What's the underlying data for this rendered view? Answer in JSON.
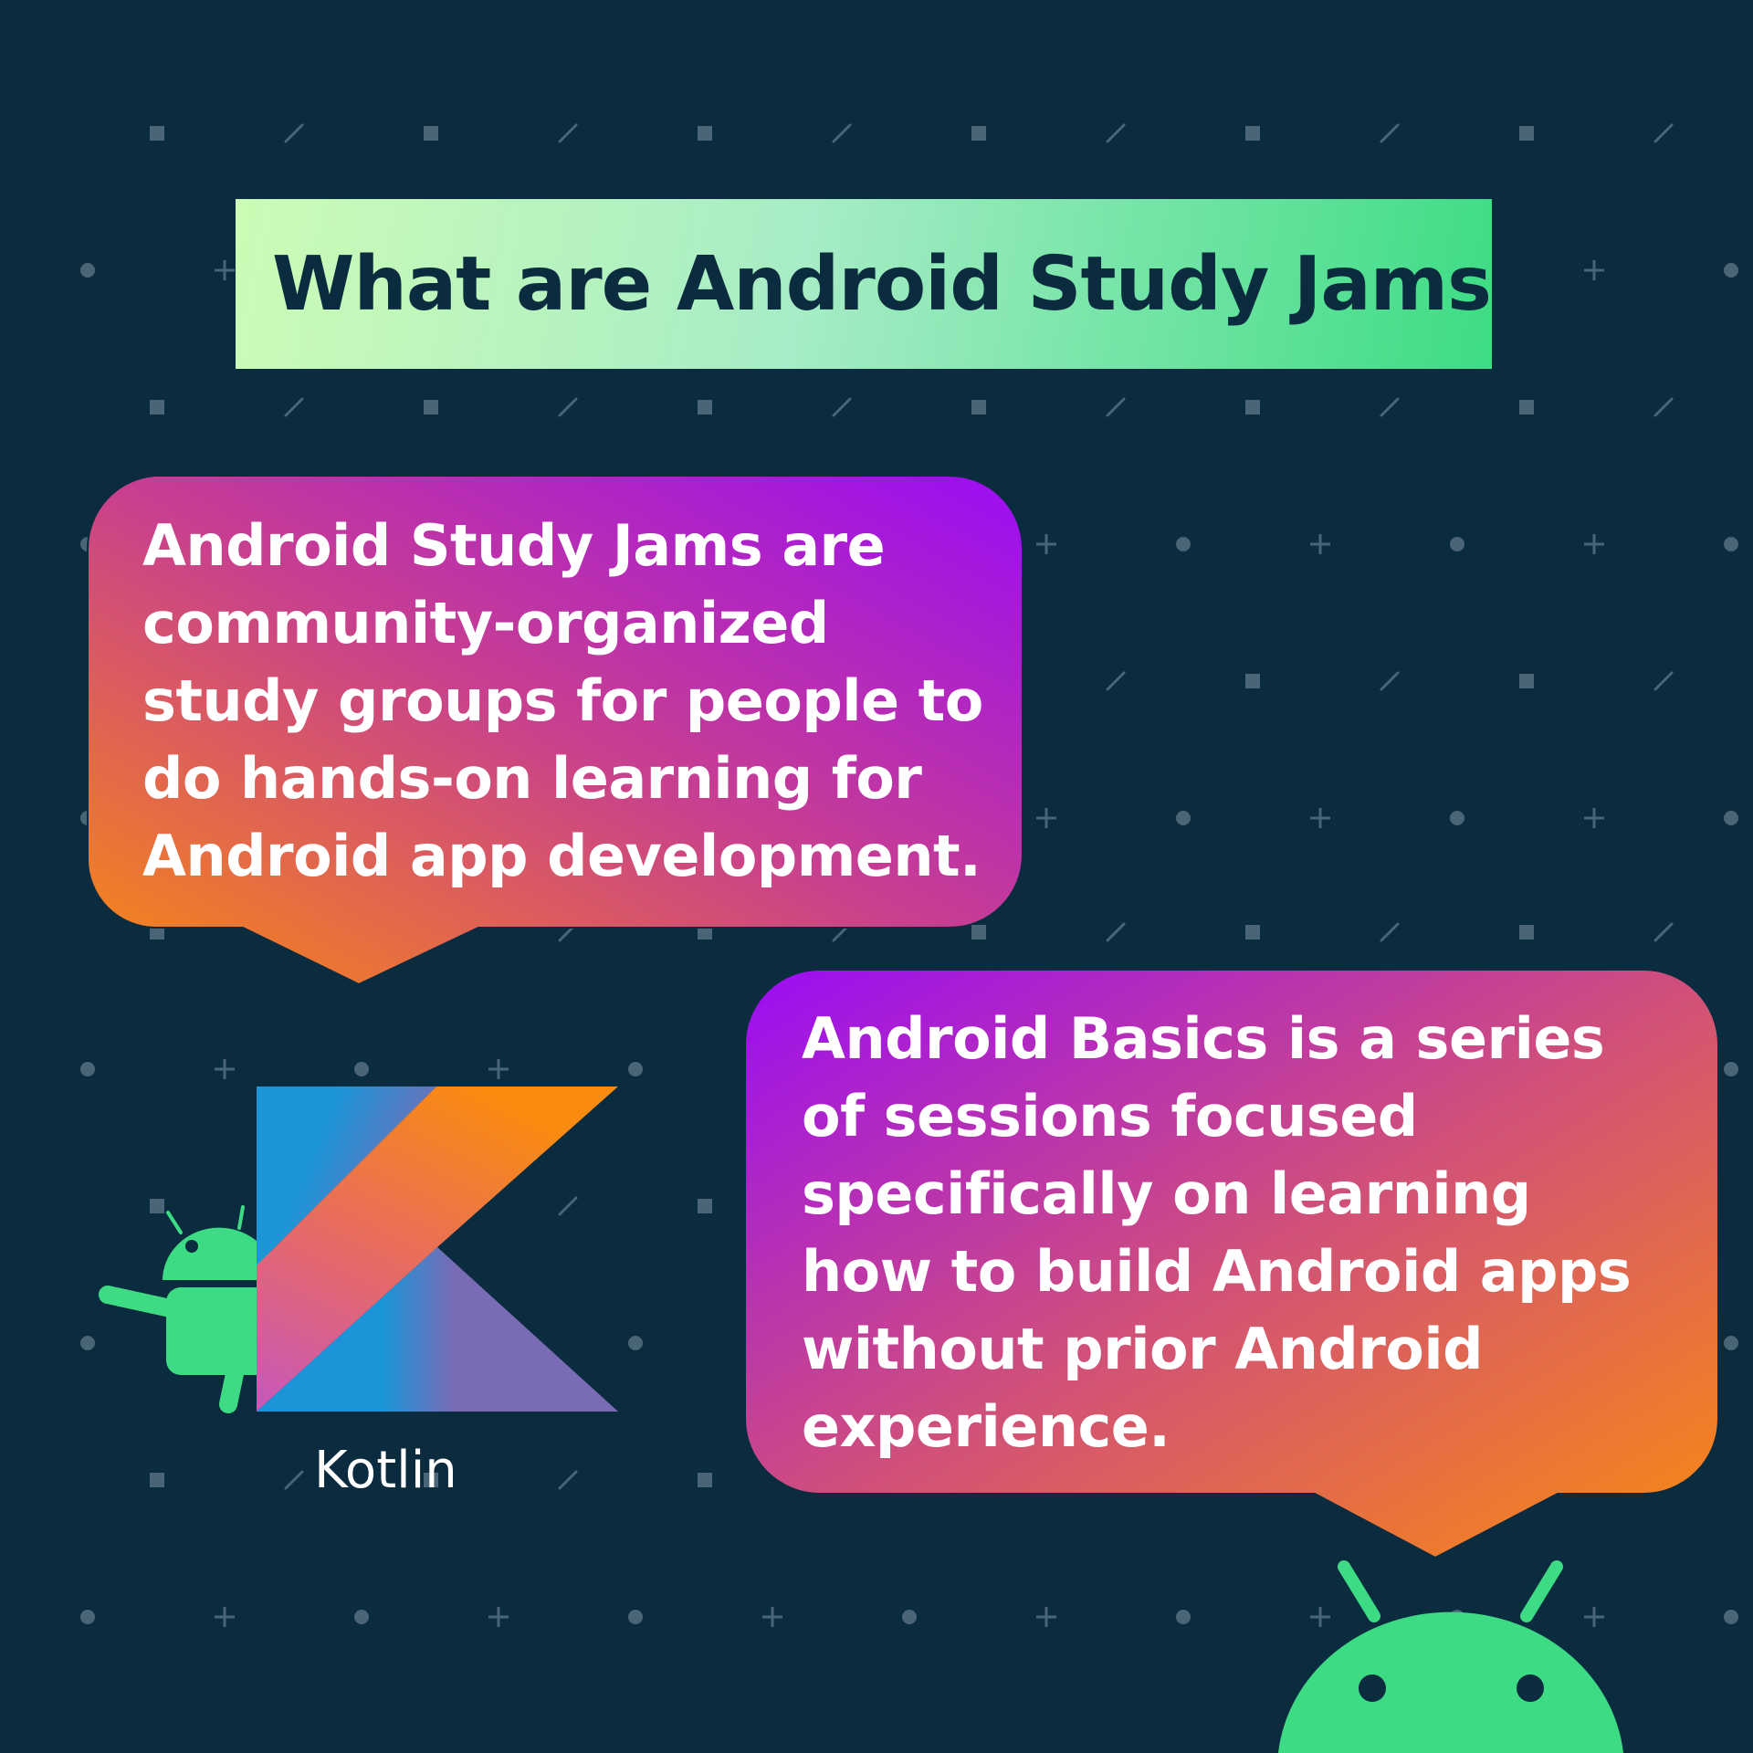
{
  "title": "What are Android Study Jams ?",
  "bubble_1": {
    "text": "Android Study Jams are\ncommunity-organized\nstudy groups for people to\ndo hands-on learning for\nAndroid app development."
  },
  "bubble_2": {
    "text": "Android Basics is a series\nof sessions focused\nspecifically on learning\nhow to build Android apps\nwithout prior Android\nexperience."
  },
  "kotlin_label": "Kotlin",
  "colors": {
    "background": "#0b2b3f",
    "android_green": "#3ddc84",
    "gradient_orange": "#f98b10",
    "gradient_purple": "#9b0cf5",
    "pattern": "#4a6575"
  },
  "icons": [
    "kotlin-logo-icon",
    "android-peeking-icon",
    "android-head-icon"
  ]
}
